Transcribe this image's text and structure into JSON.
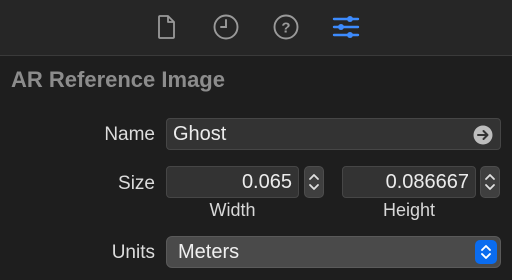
{
  "toolbar": {
    "icons": [
      "file-icon",
      "history-icon",
      "help-icon",
      "attributes-icon"
    ],
    "active_color": "#3d8bfd",
    "inactive_color": "#9a9a9a"
  },
  "section": {
    "title": "AR Reference Image"
  },
  "name_row": {
    "label": "Name",
    "value": "Ghost"
  },
  "size_row": {
    "label": "Size",
    "width_value": "0.065",
    "height_value": "0.086667",
    "width_caption": "Width",
    "height_caption": "Height"
  },
  "units_row": {
    "label": "Units",
    "selected": "Meters"
  },
  "accent": "#0a6cf0"
}
